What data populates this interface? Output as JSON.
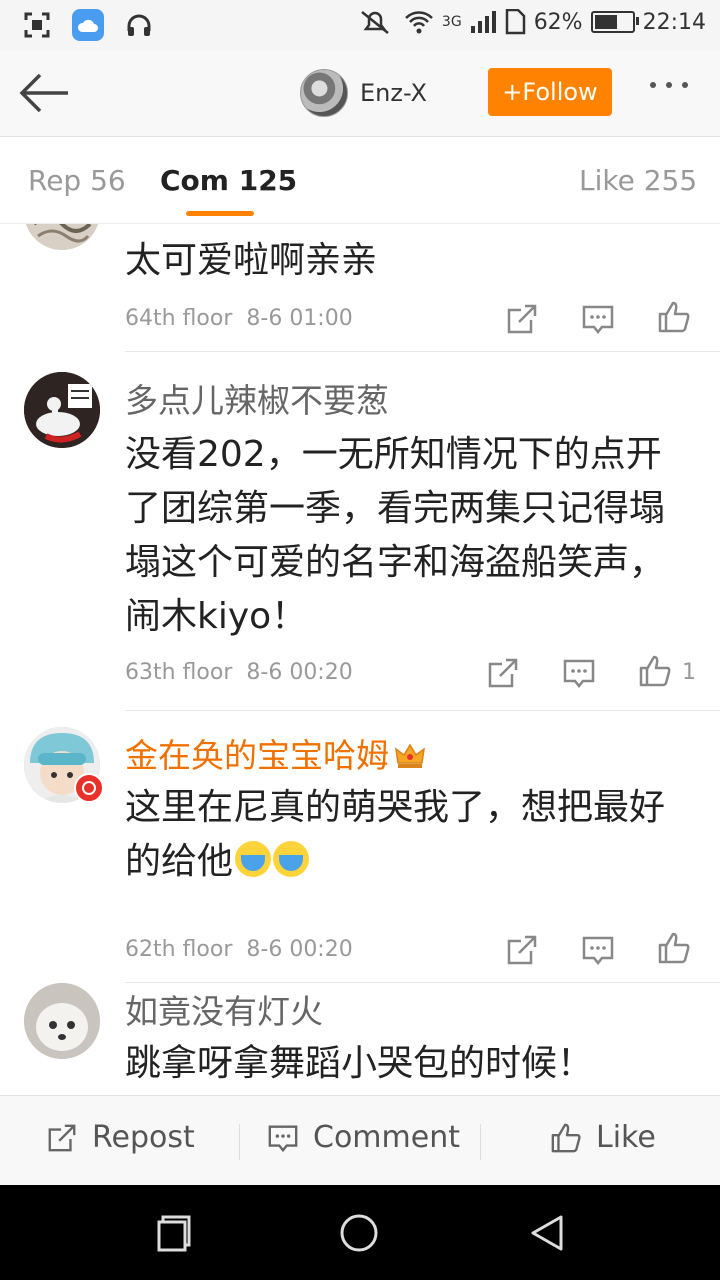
{
  "status_bar": {
    "battery": "62%",
    "battery_level": 0.62,
    "time": "22:14",
    "network": "3G"
  },
  "header": {
    "username": "Enz-X",
    "follow_label": "+Follow"
  },
  "tabs": [
    {
      "label": "Rep 56",
      "active": false
    },
    {
      "label": "Com 125",
      "active": true
    },
    {
      "label": "Like 255",
      "active": false
    }
  ],
  "comments": [
    {
      "name": "",
      "text": "太可爱啦啊亲亲",
      "floor": "64th floor",
      "time": "8-6 01:00",
      "likes": ""
    },
    {
      "name": "多点儿辣椒不要葱",
      "text": "没看202，一无所知情况下的点开了团综第一季，看完两集只记得塌塌这个可爱的名字和海盗船笑声，闹木kiyo！",
      "floor": "63th floor",
      "time": "8-6 00:20",
      "likes": "1"
    },
    {
      "name": "金在奂的宝宝哈姆",
      "text": "这里在尼真的萌哭我了，想把最好的给他",
      "floor": "62th floor",
      "time": "8-6 00:20",
      "likes": ""
    },
    {
      "name": "如竟没有灯火",
      "text": "跳拿呀拿舞蹈小哭包的时候！",
      "floor": "",
      "time": "",
      "likes": ""
    }
  ],
  "bottom_bar": {
    "repost": "Repost",
    "comment": "Comment",
    "like": "Like"
  },
  "colors": {
    "accent": "#ff8200",
    "vip_name": "#f07000"
  }
}
